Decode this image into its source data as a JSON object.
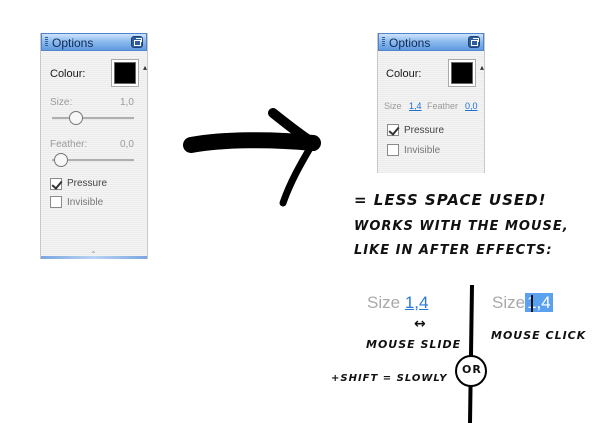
{
  "left_panel": {
    "title": "Options",
    "colour_label": "Colour:",
    "size_label": "Size:",
    "size_value": "1,0",
    "feather_label": "Feather:",
    "feather_value": "0,0",
    "pressure_label": "Pressure",
    "pressure_checked": true,
    "invisible_label": "Invisible",
    "invisible_checked": false
  },
  "right_panel": {
    "title": "Options",
    "colour_label": "Colour:",
    "size_label": "Size",
    "size_value": "1,4",
    "feather_label": "Feather",
    "feather_value": "0,0",
    "pressure_label": "Pressure",
    "pressure_checked": true,
    "invisible_label": "Invisible",
    "invisible_checked": false
  },
  "annotation": {
    "line1": "= LESS SPACE USED!",
    "line2": "WORKS WITH THE MOUSE,",
    "line3": "LIKE IN AFTER EFFECTS:"
  },
  "demo": {
    "left_label": "Size",
    "left_value": "1,4",
    "right_label": "Size",
    "right_value": "1,4",
    "double_arrow": "↔",
    "mouse_slide": "MOUSE SLIDE",
    "shift_note": "+SHIFT = SLOWLY",
    "or_label": "OR",
    "mouse_click": "MOUSE CLICK"
  },
  "colors": {
    "titlebar": "#8fbcef",
    "link": "#1f6fd1",
    "selection": "#5aa2f0"
  }
}
